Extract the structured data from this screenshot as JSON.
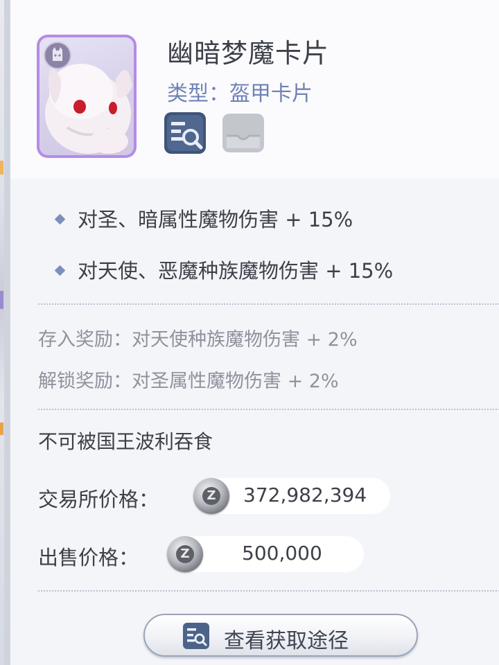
{
  "card": {
    "name": "幽暗梦魔卡片",
    "type_label": "类型：",
    "type_value": "盔甲卡片",
    "art": "white-rabbit-nightmare-card",
    "frame_color": "#b58be6"
  },
  "icons": {
    "view": "view-details-icon",
    "secondary": "card-slot-icon"
  },
  "stats": [
    {
      "text": "对圣、暗属性魔物伤害 + 15%"
    },
    {
      "text": "对天使、恶魔种族魔物伤害 + 15%"
    }
  ],
  "bonuses": {
    "deposit": "存入奖励：对天使种族魔物伤害 + 2%",
    "unlock": "解锁奖励：对圣属性魔物伤害 + 2%"
  },
  "note": "不可被国王波利吞食",
  "prices": {
    "exchange_label": "交易所价格：",
    "exchange_value": "372,982,394",
    "sell_label": "出售价格：",
    "sell_value": "500,000",
    "currency_icon": "zeny-coin-icon"
  },
  "actions": {
    "acquire_label": "查看获取途径"
  },
  "colors": {
    "accent_blue": "#6f82b6",
    "bullet": "#7c8fbd",
    "text_dark": "#3d4048",
    "text_muted": "#8e929c"
  }
}
